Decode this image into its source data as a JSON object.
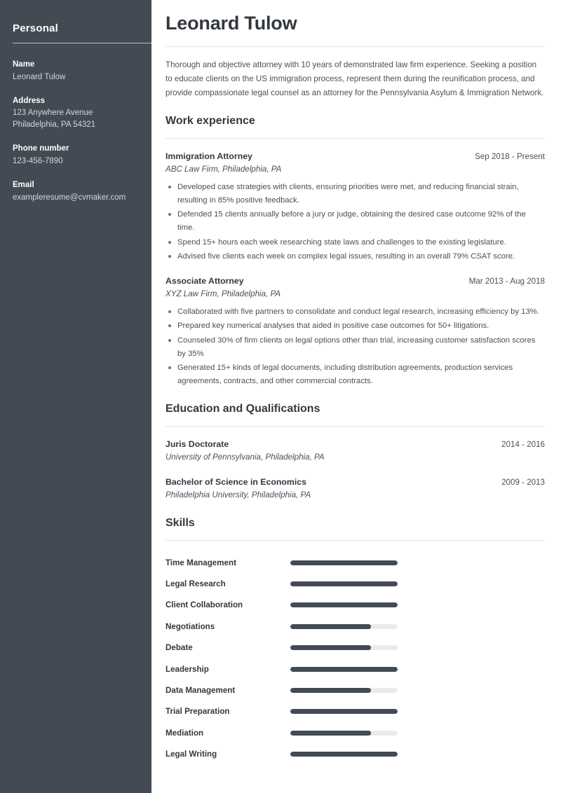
{
  "theme": {
    "sidebar_bg": "#434a54",
    "accent": "#434a54",
    "track": "#ebebeb",
    "text": "#4a5059",
    "heading": "#33383f"
  },
  "sidebar": {
    "title": "Personal",
    "fields": [
      {
        "label": "Name",
        "lines": [
          "Leonard Tulow"
        ]
      },
      {
        "label": "Address",
        "lines": [
          "123 Anywhere Avenue",
          "Philadelphia, PA 54321"
        ]
      },
      {
        "label": "Phone number",
        "lines": [
          "123-456-7890"
        ]
      },
      {
        "label": "Email",
        "lines": [
          "exampleresume@cvmaker.com"
        ]
      }
    ]
  },
  "header": {
    "full_name": "Leonard Tulow",
    "summary": "Thorough and objective attorney with 10 years of demonstrated law firm experience. Seeking a position to educate clients on the US immigration process, represent them during the reunification process, and provide compassionate legal counsel as an attorney for the Pennsylvania Asylum & Immigration Network."
  },
  "work": {
    "title": "Work experience",
    "entries": [
      {
        "role": "Immigration Attorney",
        "dates": "Sep 2018 - Present",
        "company": "ABC Law Firm, Philadelphia, PA",
        "bullets": [
          "Developed case strategies with clients, ensuring priorities were met, and reducing financial strain, resulting in 85% positive feedback.",
          "Defended 15 clients annually before a jury or judge, obtaining the desired case outcome 92% of the time.",
          "Spend 15+ hours each week researching state laws and challenges to the existing legislature.",
          "Advised five clients each week on complex legal issues, resulting in an overall 79% CSAT score."
        ]
      },
      {
        "role": "Associate Attorney",
        "dates": "Mar 2013 - Aug 2018",
        "company": "XYZ Law Firm, Philadelphia, PA",
        "bullets": [
          "Collaborated with five partners to consolidate and conduct legal research, increasing efficiency by 13%.",
          "Prepared key numerical analyses that aided in positive case outcomes for 50+ litigations.",
          "Counseled 30% of firm clients on legal options other than trial, increasing customer satisfaction scores by 35%",
          "Generated 15+ kinds of legal documents, including distribution agreements, production services agreements, contracts, and other commercial contracts."
        ]
      }
    ]
  },
  "education": {
    "title": "Education and Qualifications",
    "entries": [
      {
        "degree": "Juris Doctorate",
        "dates": "2014 - 2016",
        "school": "University of Pennsylvania, Philadelphia, PA"
      },
      {
        "degree": "Bachelor of Science in Economics",
        "dates": "2009 - 2013",
        "school": "Philadelphia University, Philadelphia, PA"
      }
    ]
  },
  "skills": {
    "title": "Skills",
    "items": [
      {
        "name": "Time Management",
        "level": 100
      },
      {
        "name": "Legal Research",
        "level": 100
      },
      {
        "name": "Client Collaboration",
        "level": 100
      },
      {
        "name": "Negotiations",
        "level": 75
      },
      {
        "name": "Debate",
        "level": 75
      },
      {
        "name": "Leadership",
        "level": 100
      },
      {
        "name": "Data Management",
        "level": 75
      },
      {
        "name": "Trial Preparation",
        "level": 100
      },
      {
        "name": "Mediation",
        "level": 75
      },
      {
        "name": "Legal Writing",
        "level": 100
      }
    ]
  }
}
